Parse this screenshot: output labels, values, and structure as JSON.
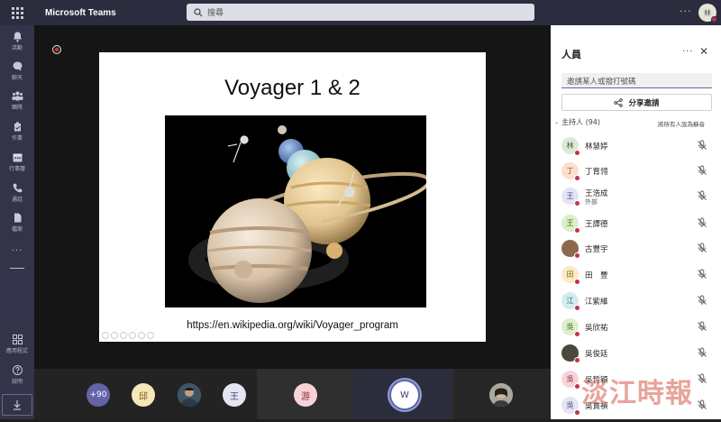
{
  "app": {
    "title": "Microsoft Teams",
    "search_placeholder": "搜尋",
    "more": "···",
    "me_initial": "林"
  },
  "rail": {
    "items": [
      {
        "label": "活動",
        "icon": "bell-icon"
      },
      {
        "label": "聊天",
        "icon": "chat-icon"
      },
      {
        "label": "團隊",
        "icon": "teams-icon"
      },
      {
        "label": "作業",
        "icon": "assignments-icon"
      },
      {
        "label": "行事曆",
        "icon": "calendar-icon"
      },
      {
        "label": "通話",
        "icon": "phone-icon"
      },
      {
        "label": "檔案",
        "icon": "file-icon"
      }
    ],
    "more": "···",
    "apps_label": "應用程式",
    "help_label": "說明"
  },
  "slide": {
    "title": "Voyager 1 & 2",
    "url": "https://en.wikipedia.org/wiki/Voyager_program"
  },
  "strip": {
    "overflow_count": "+90",
    "tiles": [
      {
        "initial": "邱",
        "bg": "#f6e7b8",
        "fg": "#7a5b12"
      },
      {
        "initial": "王",
        "bg": "#e4e4f5",
        "fg": "#464775"
      },
      {
        "initial": "游",
        "bg": "#f7d3d8",
        "fg": "#8a2a3b"
      },
      {
        "initial": "W",
        "bg": "#ffffff",
        "fg": "#3b3c76"
      }
    ]
  },
  "people": {
    "title": "人員",
    "more": "···",
    "invite_placeholder": "邀請某人或撥打號碼",
    "share_label": "分享邀請",
    "section": {
      "label": "主持人 (94)",
      "mute_all": "將所有人設為靜音"
    },
    "list": [
      {
        "initial": "林",
        "name": "林慧婷",
        "sub": "",
        "bg": "#dde9d6",
        "fg": "#3d6b2c"
      },
      {
        "initial": "丁",
        "name": "丁育翎",
        "sub": "",
        "bg": "#fbe0cf",
        "fg": "#a2521e"
      },
      {
        "initial": "王",
        "name": "王浩成",
        "sub": "外部",
        "bg": "#e4e4f5",
        "fg": "#464775"
      },
      {
        "initial": "王",
        "name": "王譯德",
        "sub": "",
        "bg": "#dcefc9",
        "fg": "#3d6b2c"
      },
      {
        "initial": "",
        "name": "古豐宇",
        "sub": "",
        "bg": "#8a6a4a",
        "fg": "#fff"
      },
      {
        "initial": "田",
        "name": "田　豐",
        "sub": "",
        "bg": "#fbeac4",
        "fg": "#8a6312"
      },
      {
        "initial": "江",
        "name": "江紫維",
        "sub": "",
        "bg": "#d4ecf0",
        "fg": "#1f6f7f"
      },
      {
        "initial": "吳",
        "name": "吳欣祐",
        "sub": "",
        "bg": "#dcefc9",
        "fg": "#3d6b2c"
      },
      {
        "initial": "",
        "name": "吳俊廷",
        "sub": "",
        "bg": "#4a4a3a",
        "fg": "#fff"
      },
      {
        "initial": "吳",
        "name": "吳哲穎",
        "sub": "",
        "bg": "#f7d3d8",
        "fg": "#8a2a3b"
      },
      {
        "initial": "吳",
        "name": "吳貫禎",
        "sub": "",
        "bg": "#e4e4f5",
        "fg": "#464775"
      }
    ]
  },
  "watermark": "淡江時報",
  "colors": {
    "titlebar": "#2b2c3e",
    "rail": "#33344a",
    "accent": "#6264a7",
    "status_busy": "#c4314b"
  }
}
